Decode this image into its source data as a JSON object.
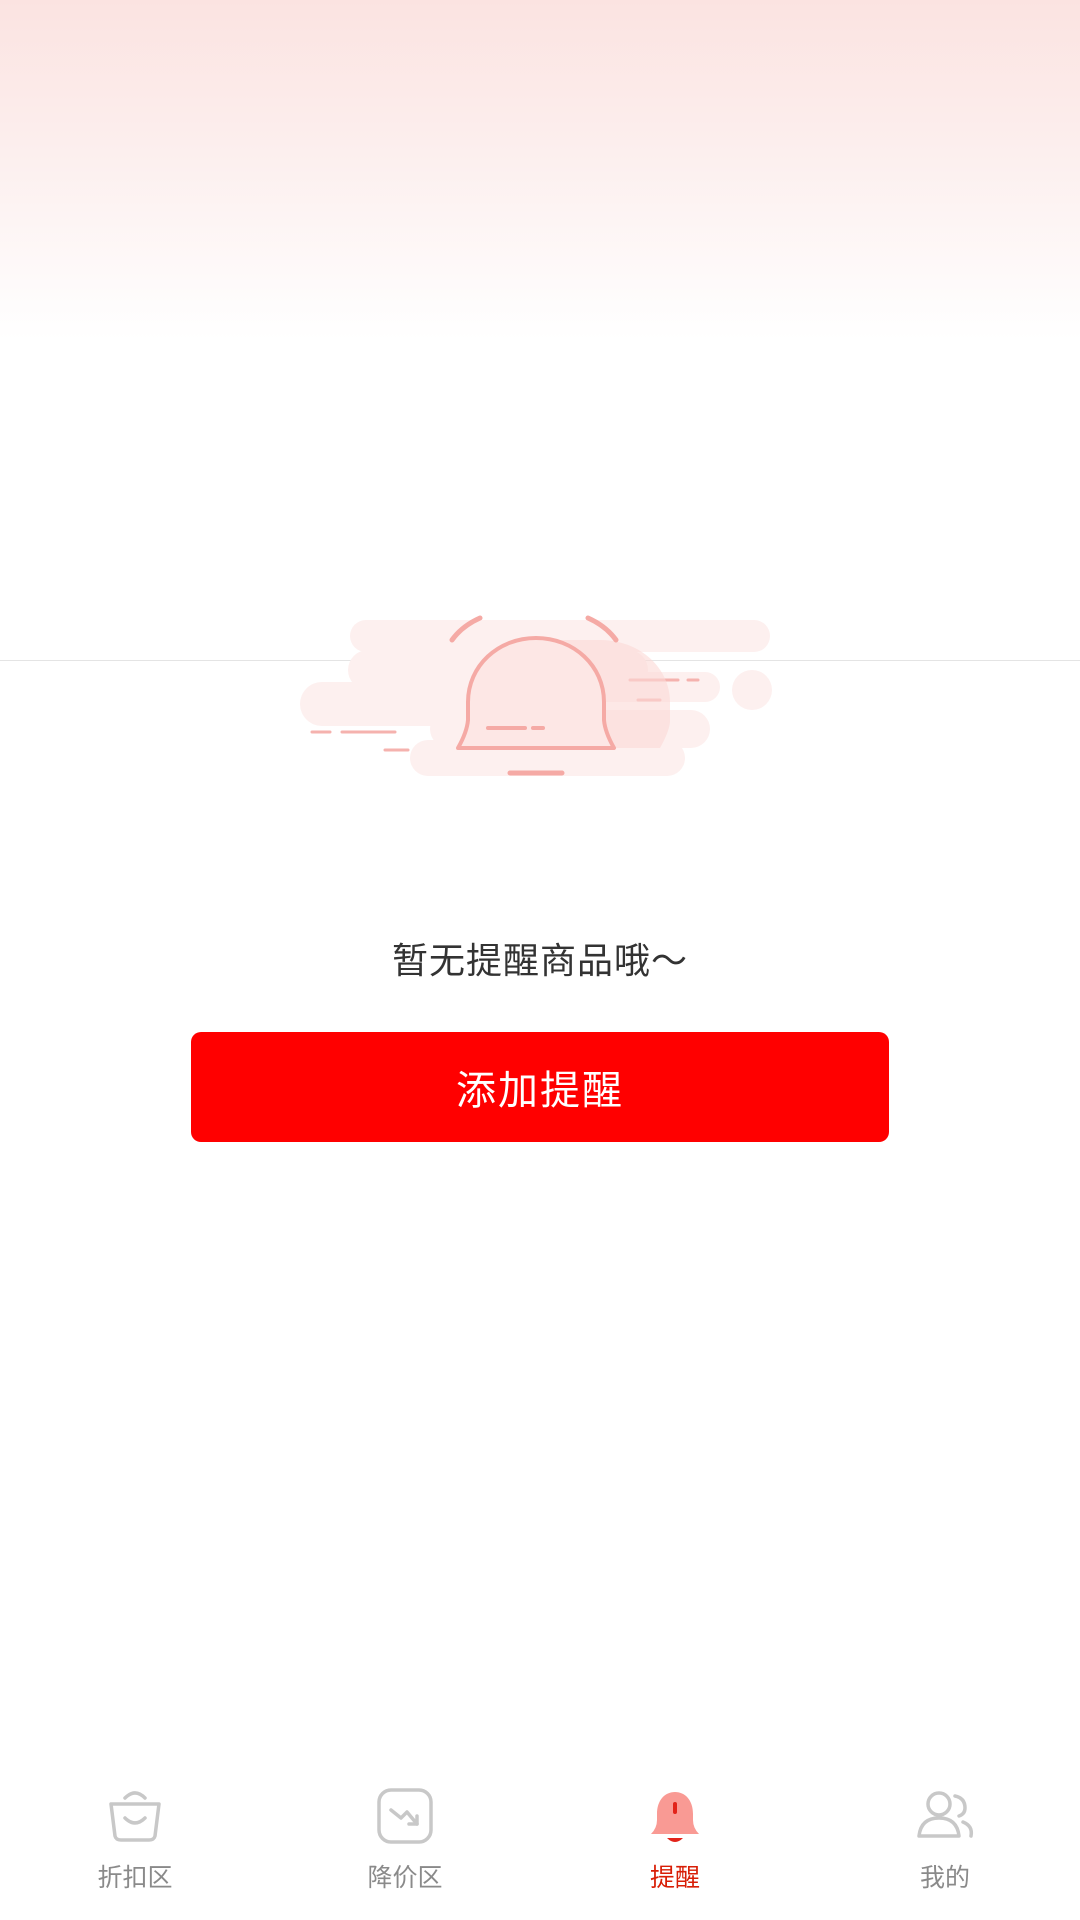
{
  "empty_state": {
    "message": "暂无提醒商品哦～",
    "add_button_label": "添加提醒"
  },
  "tabbar": {
    "active_index": 2,
    "active_color": "#d81e06",
    "inactive_color": "#8a8a8a",
    "items": [
      {
        "label": "折扣区",
        "icon": "shopping-basket-icon"
      },
      {
        "label": "降价区",
        "icon": "price-drop-icon"
      },
      {
        "label": "提醒",
        "icon": "bell-icon"
      },
      {
        "label": "我的",
        "icon": "user-profile-icon"
      }
    ]
  },
  "colors": {
    "accent": "#ff0000",
    "header_gradient_top": "#fbe3e1"
  }
}
